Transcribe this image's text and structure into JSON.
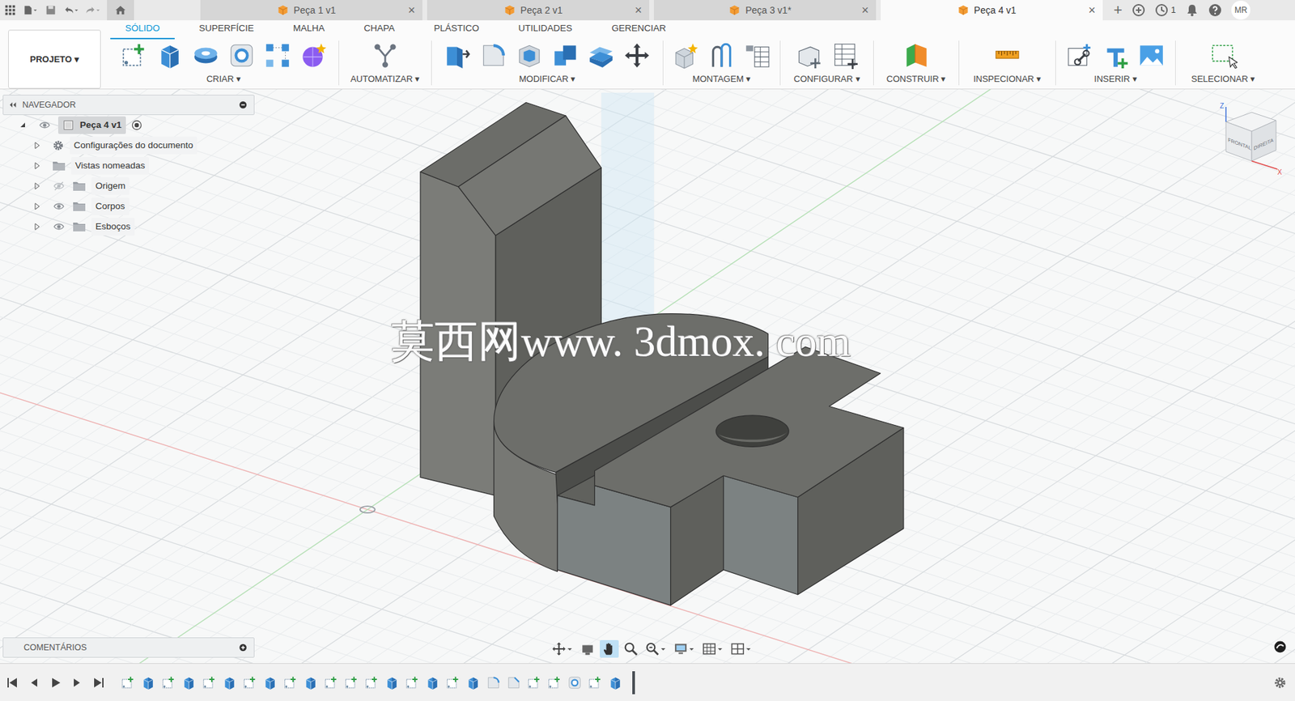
{
  "app_bar": {
    "doc_tabs": [
      {
        "label": "Peça 1 v1",
        "close": "×",
        "selected": false
      },
      {
        "label": "Peça 2 v1",
        "close": "×",
        "selected": false
      },
      {
        "label": "Peça 3 v1*",
        "close": "×",
        "selected": false
      },
      {
        "label": "Peça 4 v1",
        "close": "×",
        "selected": true
      }
    ],
    "new_tab": "+",
    "job_count": "1",
    "user": "MR"
  },
  "toolbar": {
    "project": "PROJETO ▾",
    "workspaces": [
      {
        "label": "SÓLIDO",
        "selected": true
      },
      {
        "label": "SUPERFÍCIE",
        "selected": false
      },
      {
        "label": "MALHA",
        "selected": false
      },
      {
        "label": "CHAPA",
        "selected": false
      },
      {
        "label": "PLÁSTICO",
        "selected": false
      },
      {
        "label": "UTILIDADES",
        "selected": false
      },
      {
        "label": "GERENCIAR",
        "selected": false
      }
    ],
    "groups": [
      {
        "label": "CRIAR ▾"
      },
      {
        "label": "AUTOMATIZAR ▾"
      },
      {
        "label": "MODIFICAR ▾"
      },
      {
        "label": "MONTAGEM ▾"
      },
      {
        "label": "CONFIGURAR ▾"
      },
      {
        "label": "CONSTRUIR ▾"
      },
      {
        "label": "INSPECIONAR ▾"
      },
      {
        "label": "INSERIR ▾"
      },
      {
        "label": "SELECIONAR ▾"
      }
    ]
  },
  "navigator": {
    "title": "NAVEGADOR",
    "items": [
      {
        "label": "Peça 4 v1",
        "kind": "component",
        "expanded": true,
        "visible": true,
        "active": true
      },
      {
        "label": "Configurações do documento",
        "kind": "settings",
        "expanded": false
      },
      {
        "label": "Vistas nomeadas",
        "kind": "views",
        "expanded": false
      },
      {
        "label": "Origem",
        "kind": "folder",
        "expanded": false,
        "visible": false
      },
      {
        "label": "Corpos",
        "kind": "folder",
        "expanded": false,
        "visible": true
      },
      {
        "label": "Esboços",
        "kind": "folder",
        "expanded": false,
        "visible": true
      }
    ]
  },
  "comments": {
    "title": "COMENTÁRIOS"
  },
  "viewport": {
    "watermark": "莫西网www. 3dmox. com"
  },
  "viewcube": {
    "faces": [
      "FRONTAL",
      "DIREITA"
    ],
    "axes": [
      {
        "label": "Z",
        "color": "#3b6fd8"
      },
      {
        "label": "X",
        "color": "#e04a4a"
      }
    ]
  },
  "nav_tools": [
    {
      "kind": "orbit",
      "selected": false
    },
    {
      "kind": "look",
      "selected": false
    },
    {
      "kind": "pan",
      "selected": true
    },
    {
      "kind": "zoom",
      "selected": false
    },
    {
      "kind": "fit",
      "selected": false
    },
    {
      "kind": "display",
      "selected": false
    },
    {
      "kind": "grid",
      "selected": false
    },
    {
      "kind": "viewports",
      "selected": false
    }
  ],
  "timeline": {
    "features": [
      {
        "kind": "sketch"
      },
      {
        "kind": "extrude"
      },
      {
        "kind": "sketch"
      },
      {
        "kind": "extrude"
      },
      {
        "kind": "sketch"
      },
      {
        "kind": "extrude"
      },
      {
        "kind": "sketch"
      },
      {
        "kind": "extrude"
      },
      {
        "kind": "sketch"
      },
      {
        "kind": "extrude"
      },
      {
        "kind": "sketch"
      },
      {
        "kind": "sketch"
      },
      {
        "kind": "sketch"
      },
      {
        "kind": "extrude"
      },
      {
        "kind": "sketch"
      },
      {
        "kind": "extrude"
      },
      {
        "kind": "sketch"
      },
      {
        "kind": "extrude"
      },
      {
        "kind": "fillet"
      },
      {
        "kind": "chamfer"
      },
      {
        "kind": "sketch"
      },
      {
        "kind": "sketch"
      },
      {
        "kind": "hole"
      },
      {
        "kind": "sketch"
      },
      {
        "kind": "extrude"
      }
    ]
  }
}
